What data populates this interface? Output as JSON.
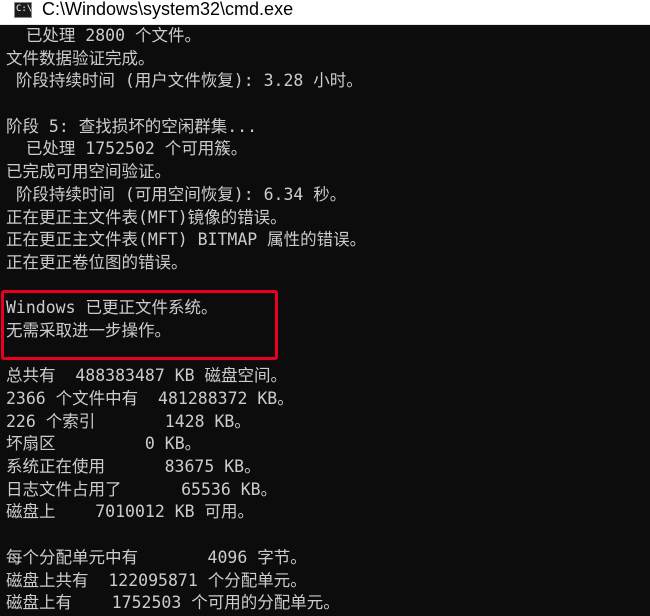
{
  "window": {
    "title": "C:\\Windows\\system32\\cmd.exe",
    "icon": "cmd-icon",
    "icon_text": "C:\\"
  },
  "colors": {
    "console_background": "#0c0c0c",
    "console_text": "#cccccc",
    "highlight_border": "#e8001c"
  },
  "console": {
    "lines": [
      "  已处理 2800 个文件。",
      "文件数据验证完成。",
      " 阶段持续时间 (用户文件恢复): 3.28 小时。",
      "",
      "阶段 5: 查找损坏的空闲群集...",
      "  已处理 1752502 个可用簇。",
      "已完成可用空间验证。",
      " 阶段持续时间 (可用空间恢复): 6.34 秒。",
      "正在更正主文件表(MFT)镜像的错误。",
      "正在更正主文件表(MFT) BITMAP 属性的错误。",
      "正在更正卷位图的错误。",
      "",
      "Windows 已更正文件系统。",
      "无需采取进一步操作。",
      "",
      "总共有  488383487 KB 磁盘空间。",
      "2366 个文件中有  481288372 KB。",
      "226 个索引       1428 KB。",
      "坏扇区         0 KB。",
      "系统正在使用      83675 KB。",
      "日志文件占用了      65536 KB。",
      "磁盘上    7010012 KB 可用。",
      "",
      "每个分配单元中有       4096 字节。",
      "磁盘上共有  122095871 个分配单元。",
      "磁盘上有    1752503 个可用的分配单元。"
    ]
  }
}
